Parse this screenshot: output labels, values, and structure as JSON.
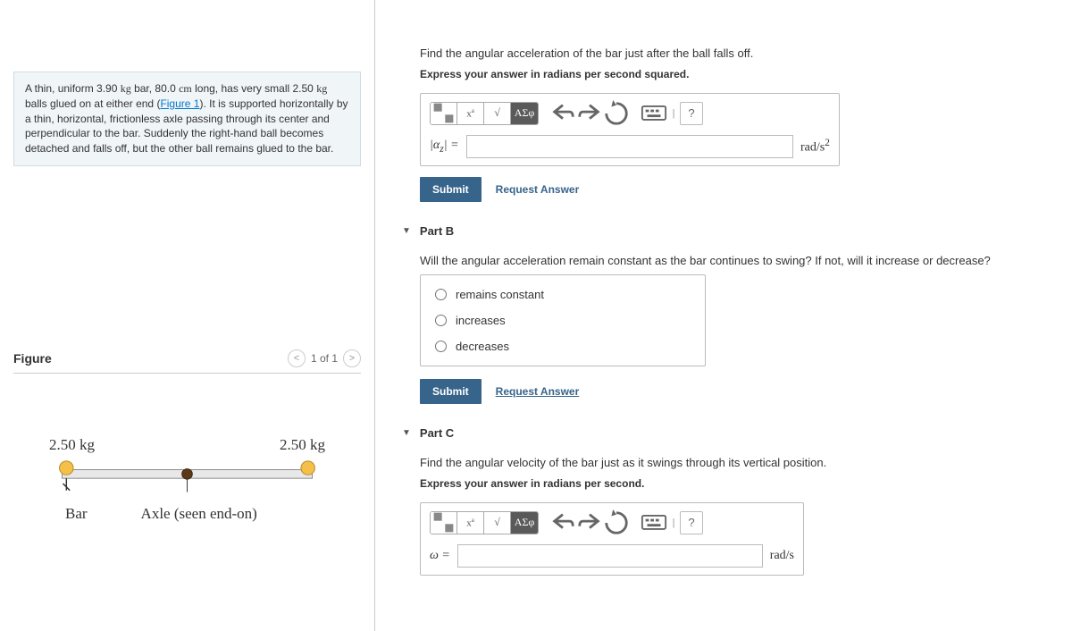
{
  "problem": {
    "text_pre": "A thin, uniform 3.90 ",
    "unit1": "kg",
    "text_mid1": " bar, 80.0 ",
    "unit2": "cm",
    "text_mid2": " long, has very small 2.50 ",
    "unit3": "kg",
    "text_mid3": " balls glued on at either end (",
    "figure_link": "Figure 1",
    "text_post": "). It is supported horizontally by a thin, horizontal, frictionless axle passing through its center and perpendicular to the bar. Suddenly the right-hand ball becomes detached and falls off, but the other ball remains glued to the bar."
  },
  "figure": {
    "title": "Figure",
    "nav_text": "1 of 1",
    "left_mass": "2.50 kg",
    "right_mass": "2.50 kg",
    "bar_label": "Bar",
    "axle_label": "Axle (seen end-on)"
  },
  "partA": {
    "question": "Find the angular acceleration of the bar just after the ball falls off.",
    "instruction": "Express your answer in radians per second squared.",
    "var_label": "|α_z| =",
    "unit": "rad/s²",
    "submit": "Submit",
    "request": "Request Answer"
  },
  "partB": {
    "title": "Part B",
    "question": "Will the angular acceleration remain constant as the bar continues to swing? If not, will it increase or decrease?",
    "options": [
      "remains constant",
      "increases",
      "decreases"
    ],
    "submit": "Submit",
    "request": "Request Answer"
  },
  "partC": {
    "title": "Part C",
    "question": "Find the angular velocity of the bar just as it swings through its vertical position.",
    "instruction": "Express your answer in radians per second.",
    "var_label": "ω =",
    "unit": "rad/s",
    "submit": "Submit"
  },
  "toolbar": {
    "greek": "ΑΣφ",
    "help": "?"
  }
}
